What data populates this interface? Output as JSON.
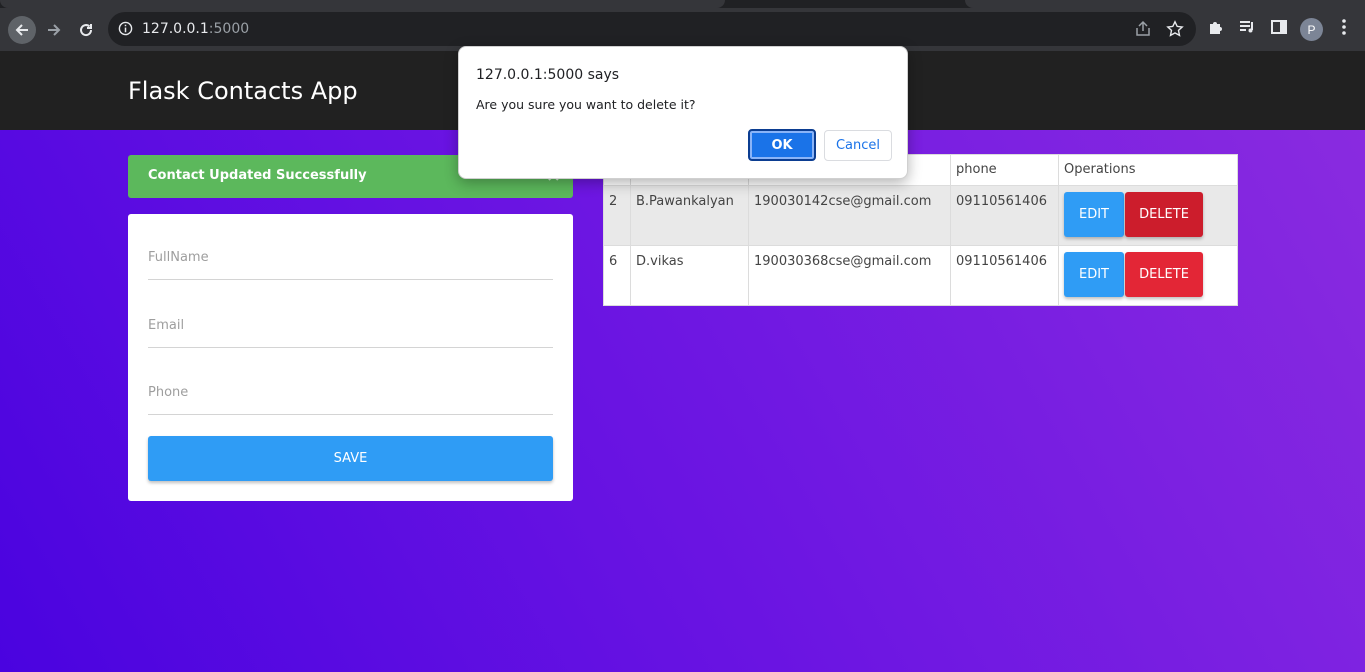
{
  "browser": {
    "url_host": "127.0.0.1",
    "url_port": ":5000",
    "profile_initial": "P"
  },
  "app": {
    "brand": "Flask Contacts App",
    "alert": {
      "message": "Contact Updated Successfully",
      "close": "×"
    },
    "form": {
      "fullname_placeholder": "FullName",
      "email_placeholder": "Email",
      "phone_placeholder": "Phone",
      "save_label": "SAVE"
    },
    "table": {
      "headers": [
        "",
        "",
        "",
        "phone",
        "Operations"
      ],
      "rows": [
        {
          "id": "2",
          "name": "B.Pawankalyan",
          "email": "190030142cse@gmail.com",
          "phone": "09110561406",
          "edit": "EDIT",
          "delete": "DELETE"
        },
        {
          "id": "6",
          "name": "D.vikas",
          "email": "190030368cse@gmail.com",
          "phone": "09110561406",
          "edit": "EDIT",
          "delete": "DELETE"
        }
      ]
    }
  },
  "dialog": {
    "title": "127.0.0.1:5000 says",
    "message": "Are you sure you want to delete it?",
    "ok_label": "OK",
    "cancel_label": "Cancel"
  },
  "colors": {
    "navbar": "#212121",
    "alert_success": "#5cb85c",
    "primary_button": "#2f9cf5",
    "danger_button": "#e32636",
    "gradient_start": "#4a03e0",
    "gradient_end": "#8b2ce0"
  }
}
